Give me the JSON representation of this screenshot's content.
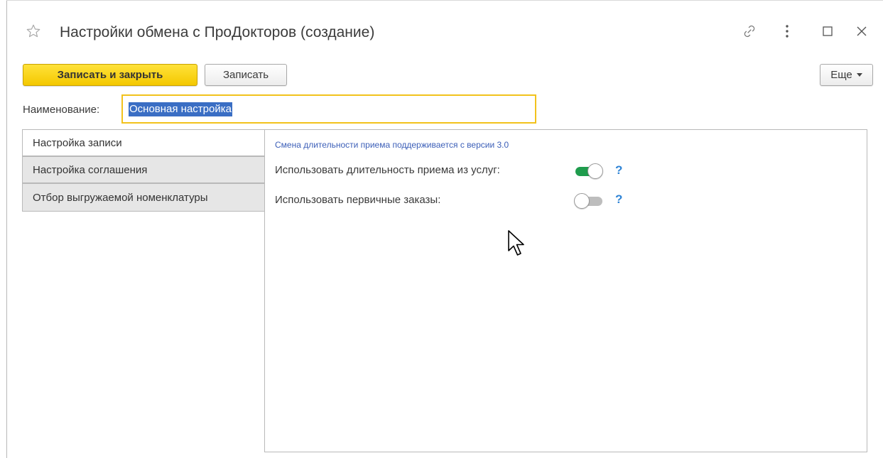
{
  "window": {
    "title": "Настройки обмена с ПроДокторов (создание)",
    "icons": [
      "star-icon",
      "link-icon",
      "more-vertical-icon",
      "maximize-icon",
      "close-icon"
    ]
  },
  "toolbar": {
    "save_close_label": "Записать и закрыть",
    "save_label": "Записать",
    "more_label": "Еще"
  },
  "name_field": {
    "label": "Наименование:",
    "value": "Основная настройка"
  },
  "tabs": [
    {
      "label": "Настройка записи",
      "active": true
    },
    {
      "label": "Настройка соглашения",
      "active": false
    },
    {
      "label": "Отбор выгружаемой номенклатуры",
      "active": false
    }
  ],
  "panel": {
    "hint": "Смена длительности приема поддерживается с версии 3.0",
    "options": [
      {
        "label": "Использовать длительность приема из услуг:",
        "enabled": true,
        "help": "?"
      },
      {
        "label": "Использовать первичные заказы:",
        "enabled": false,
        "help": "?"
      }
    ]
  },
  "colors": {
    "primary_button": "#f4c800",
    "focus_border": "#f2c21c",
    "selection": "#3a6ec4",
    "toggle_on": "#1f9c4d",
    "toggle_off": "#bdbdbd",
    "hint_text": "#3c5fb8",
    "help_icon": "#2f84d6"
  }
}
